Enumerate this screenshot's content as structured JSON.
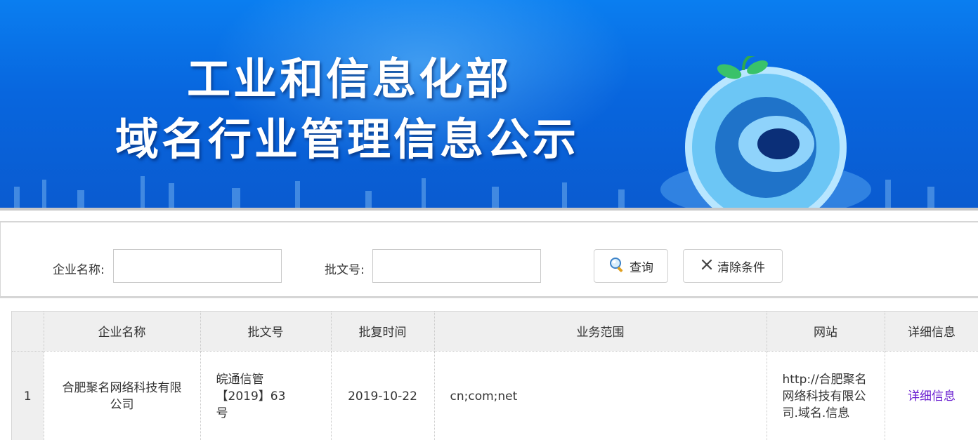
{
  "banner": {
    "title_line1": "工业和信息化部",
    "title_line2": "域名行业管理信息公示"
  },
  "search": {
    "company_label": "企业名称:",
    "company_value": "",
    "approval_label": "批文号:",
    "approval_value": "",
    "query_button": "查询",
    "clear_button": "清除条件"
  },
  "table": {
    "headers": [
      "企业名称",
      "批文号",
      "批复时间",
      "业务范围",
      "网站",
      "详细信息"
    ],
    "rows": [
      {
        "index": "1",
        "company": "合肥聚名网络科技有限公司",
        "approval": "皖通信管【2019】63号",
        "date": "2019-10-22",
        "scope": "cn;com;net",
        "website": "http://合肥聚名网络科技有限公司.域名.信息",
        "detail": "详细信息"
      }
    ]
  },
  "colors": {
    "banner_blue": "#0866de",
    "link_purple": "#6a1fd0",
    "header_gray": "#efefef"
  }
}
